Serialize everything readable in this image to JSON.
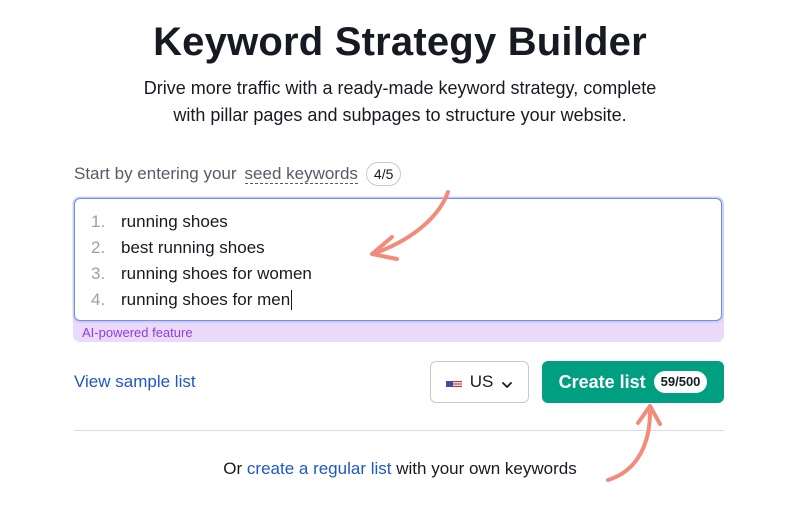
{
  "header": {
    "title": "Keyword Strategy Builder",
    "subtitle_line1": "Drive more traffic with a ready-made keyword strategy, complete",
    "subtitle_line2": "with pillar pages and subpages to structure your website."
  },
  "seed": {
    "label_prefix": "Start by entering your",
    "label_term": "seed keywords",
    "count": "4/5",
    "keywords": [
      {
        "num": "1.",
        "text": "running shoes"
      },
      {
        "num": "2.",
        "text": "best running shoes"
      },
      {
        "num": "3.",
        "text": "running shoes for women"
      },
      {
        "num": "4.",
        "text": "running shoes for men"
      }
    ],
    "ai_label": "AI-powered feature"
  },
  "actions": {
    "sample_link": "View sample list",
    "country": "US",
    "country_icon": "us-flag-icon",
    "create_label": "Create list",
    "create_limit": "59/500"
  },
  "footer": {
    "prefix": "Or",
    "link": "create a regular list",
    "suffix": "with your own keywords"
  },
  "colors": {
    "primary_button": "#009f81",
    "link": "#1f57c3",
    "ai_bg": "#ead9fb",
    "ai_text": "#8c3fd6",
    "annotation_arrow": "#f48a7a"
  }
}
